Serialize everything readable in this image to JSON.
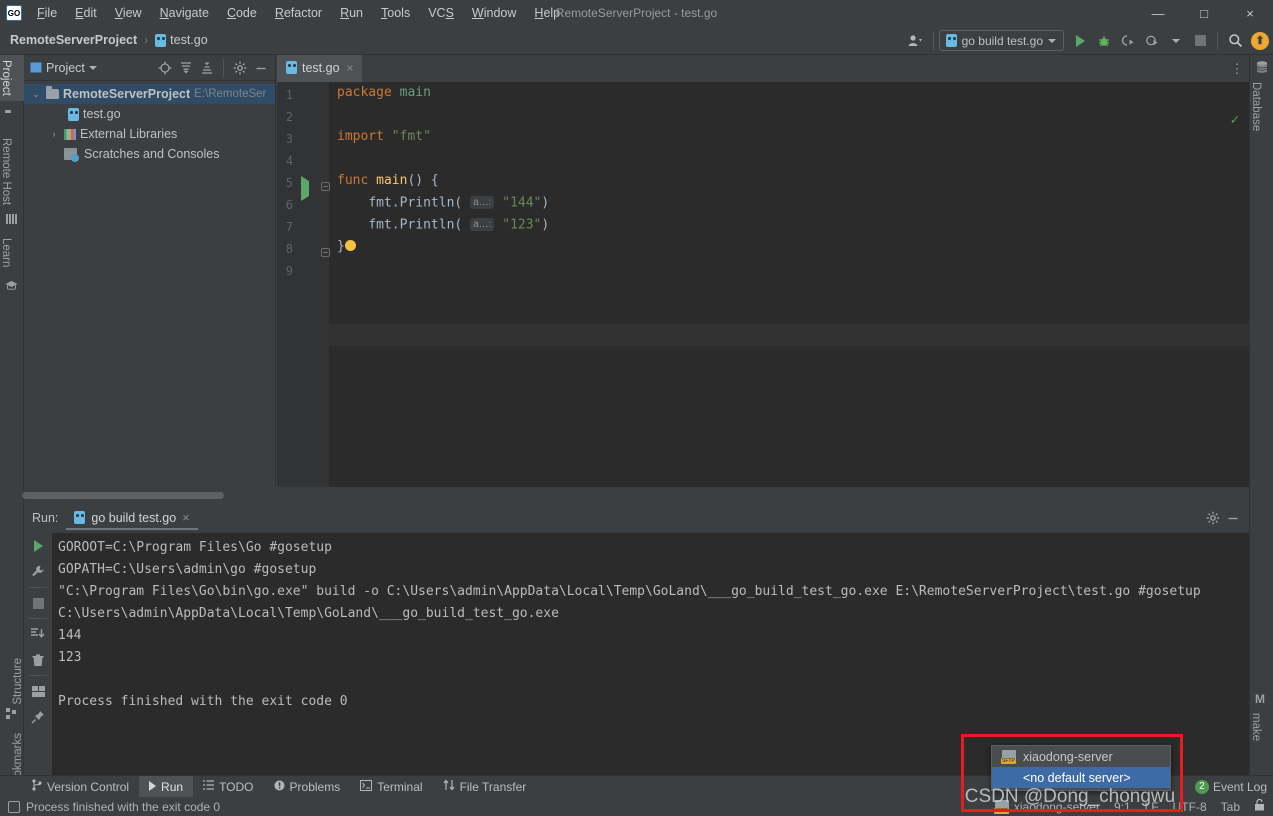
{
  "window": {
    "title": "RemoteServerProject - test.go",
    "app_icon": "GO",
    "minimize": "—",
    "maximize": "□",
    "close": "×"
  },
  "menu": {
    "items": [
      {
        "label": "File"
      },
      {
        "label": "Edit"
      },
      {
        "label": "View"
      },
      {
        "label": "Navigate"
      },
      {
        "label": "Code"
      },
      {
        "label": "Refactor"
      },
      {
        "label": "Run"
      },
      {
        "label": "Tools"
      },
      {
        "label": "VCS"
      },
      {
        "label": "Window"
      },
      {
        "label": "Help"
      }
    ]
  },
  "navbar": {
    "breadcrumb": {
      "project": "RemoteServerProject",
      "separator": "›",
      "file": "test.go"
    },
    "run_config": "go build test.go",
    "icons": {
      "account": "account-icon",
      "run": "run-icon",
      "debug": "debug-icon",
      "coverage": "coverage-icon",
      "profile": "profile-icon",
      "stop": "stop-icon",
      "search": "search-icon",
      "update": "⬆"
    }
  },
  "left_strip": {
    "top": [
      {
        "label": "Project",
        "icon": "folder-icon",
        "active": true
      },
      {
        "label": "Remote Host",
        "icon": "remote-host-icon",
        "active": false
      },
      {
        "label": "Learn",
        "icon": "learn-icon",
        "active": false
      }
    ],
    "bottom": [
      {
        "label": "Structure",
        "icon": "structure-icon"
      },
      {
        "label": "Bookmarks",
        "icon": "bookmark-icon"
      }
    ]
  },
  "right_strip": {
    "top": [
      {
        "label": "Database",
        "icon": "database-icon"
      }
    ],
    "bottom": [
      {
        "label": "make",
        "icon": "make-icon"
      }
    ]
  },
  "project_panel": {
    "title": "Project",
    "toolbar_icons": [
      "locate-icon",
      "expand-all-icon",
      "collapse-all-icon",
      "gear-icon",
      "minimize-icon"
    ],
    "tree": [
      {
        "label": "RemoteServerProject",
        "path": "E:\\RemoteSer",
        "depth": 0,
        "icon": "folder-icon",
        "arrow": "⌄",
        "selected": true,
        "bold": true
      },
      {
        "label": "test.go",
        "path": "",
        "depth": 1,
        "icon": "go-file-icon",
        "arrow": "",
        "selected": false,
        "bold": false
      },
      {
        "label": "External Libraries",
        "path": "",
        "depth": 0,
        "icon": "library-icon",
        "arrow": "›",
        "selected": false,
        "bold": false
      },
      {
        "label": "Scratches and Consoles",
        "path": "",
        "depth": 0,
        "icon": "scratches-icon",
        "arrow": "",
        "selected": false,
        "bold": false
      }
    ]
  },
  "editor": {
    "tab": {
      "label": "test.go",
      "icon": "go-file-icon",
      "close": "×"
    },
    "options_icon": "⋮",
    "inspection_status": "✓",
    "line_numbers": [
      "1",
      "2",
      "3",
      "4",
      "5",
      "6",
      "7",
      "8",
      "9"
    ],
    "hint_label": "a…:",
    "code": {
      "l1_kw": "package",
      "l1_name": "main",
      "l3_kw": "import",
      "l3_str": "\"fmt\"",
      "l5_kw": "func",
      "l5_name": "main",
      "l5_rest": "() {",
      "l6_obj": "fmt",
      "l6_fn": ".Println(",
      "l6_str": "\"144\"",
      "l6_end": ")",
      "l7_obj": "fmt",
      "l7_fn": ".Println(",
      "l7_str": "\"123\"",
      "l7_end": ")",
      "l8": "}"
    }
  },
  "run_window": {
    "label": "Run:",
    "tab": "go build test.go",
    "tab_close": "×",
    "gutter_icons": [
      "rerun-icon",
      "settings-wrench-icon",
      "stop-icon",
      "scroll-to-end-icon",
      "trash-icon",
      "layout-icon",
      "pin-icon"
    ],
    "header_icons": [
      "gear-icon",
      "minimize-icon"
    ],
    "console": [
      "GOROOT=C:\\Program Files\\Go #gosetup",
      "GOPATH=C:\\Users\\admin\\go #gosetup",
      "\"C:\\Program Files\\Go\\bin\\go.exe\" build -o C:\\Users\\admin\\AppData\\Local\\Temp\\GoLand\\___go_build_test_go.exe E:\\RemoteServerProject\\test.go #gosetup",
      "C:\\Users\\admin\\AppData\\Local\\Temp\\GoLand\\___go_build_test_go.exe",
      "144",
      "123",
      "",
      "Process finished with the exit code 0"
    ]
  },
  "bottom_tabs": [
    {
      "label": "Version Control",
      "icon": "branch-icon",
      "active": false
    },
    {
      "label": "Run",
      "icon": "run-icon",
      "active": true
    },
    {
      "label": "TODO",
      "icon": "todo-icon",
      "active": false
    },
    {
      "label": "Problems",
      "icon": "problems-icon",
      "active": false
    },
    {
      "label": "Terminal",
      "icon": "terminal-icon",
      "active": false
    },
    {
      "label": "File Transfer",
      "icon": "file-transfer-icon",
      "active": false
    }
  ],
  "event_log": {
    "label": "Event Log",
    "count": "2"
  },
  "statusbar": {
    "message": "Process finished with the exit code 0",
    "message_icon": "console-icon",
    "server": "xiaodong-server",
    "server_icon": "sftp-icon",
    "caret": "9:1",
    "line_sep": "LF",
    "encoding": "UTF-8",
    "indent": "Tab",
    "lock_icon": "🔓"
  },
  "server_popup": {
    "items": [
      {
        "label": "xiaodong-server",
        "icon": "sftp-icon",
        "selected": false
      },
      {
        "label": "<no default server>",
        "icon": "",
        "selected": true
      }
    ],
    "highlight_color": "#e81c1c"
  },
  "watermark": "CSDN @Dong_chongwu"
}
